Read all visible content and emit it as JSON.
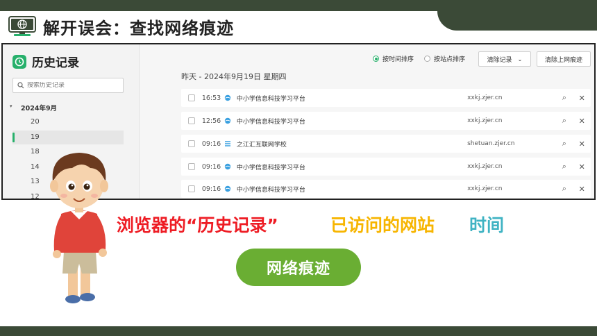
{
  "header": {
    "title": "解开误会：查找网络痕迹"
  },
  "history": {
    "title": "历史记录",
    "search_placeholder": "搜索历史记录",
    "month": "2024年9月",
    "days": [
      "20",
      "19",
      "18",
      "14",
      "13",
      "12"
    ],
    "active_day": "19",
    "sort_by_time": "按时间排序",
    "sort_by_site": "按站点排序",
    "clear_button": "清除记录",
    "clear_traces_button": "清除上网痕迹",
    "date_heading": "昨天 - 2024年9月19日 星期四",
    "rows": [
      {
        "time": "16:53",
        "site": "中小学信息科技学习平台",
        "url": "xxkj.zjer.cn"
      },
      {
        "time": "12:56",
        "site": "中小学信息科技学习平台",
        "url": "xxkj.zjer.cn"
      },
      {
        "time": "09:16",
        "site": "之江汇互联网学校",
        "url": "shetuan.zjer.cn"
      },
      {
        "time": "09:16",
        "site": "中小学信息科技学习平台",
        "url": "xxkj.zjer.cn"
      },
      {
        "time": "09:16",
        "site": "中小学信息科技学习平台",
        "url": "xxkj.zjer.cn"
      }
    ]
  },
  "captions": {
    "history_label": "浏览器的“历史记录”",
    "visited_label": "已访问的网站",
    "time_label": "时间",
    "traces_button": "网络痕迹"
  },
  "colors": {
    "theme_dark": "#3b4a37",
    "accent_green": "#27b06b",
    "red": "#ee1c24",
    "yellow": "#f7b500",
    "teal": "#3fb3c3",
    "pill_green": "#6aae33"
  }
}
